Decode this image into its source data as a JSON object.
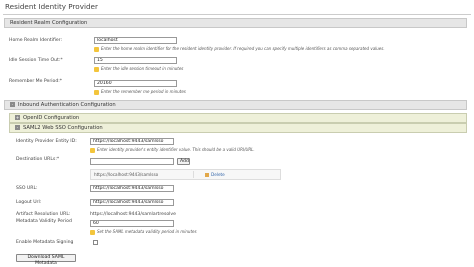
{
  "page": {
    "title": "Resident Identity Provider"
  },
  "realm": {
    "header": "Resident Realm Configuration",
    "home_realm": {
      "label": "Home Realm Identifier:",
      "value": "localhost",
      "help": "Enter the home realm identifier for the resident identity provider. If required you can specify multiple identifiers as comma separated values."
    },
    "idle": {
      "label": "Idle Session Time Out:*",
      "value": "15",
      "help": "Enter the idle session timeout in minutes"
    },
    "remember": {
      "label": "Remember Me Period:*",
      "value": "20160",
      "help": "Enter the remember me period in minutes"
    }
  },
  "inbound": {
    "header": "Inbound Authentication Configuration",
    "toggle": "-"
  },
  "openid": {
    "header": "OpenID Configuration",
    "toggle": "+"
  },
  "saml": {
    "header": "SAML2 Web SSO Configuration",
    "toggle": "-",
    "entity": {
      "label": "Identity Provider Entity ID:",
      "value": "https://localhost:9443/samlsso",
      "help": "Enter identity provider's entity identifier value. This should be a valid URI/URL."
    },
    "dest": {
      "label": "Destination URLs:*",
      "value": "",
      "add_label": "Add",
      "item": "https://localhost:9443/samlsso",
      "delete_label": "Delete"
    },
    "sso_url": {
      "label": "SSO URL:",
      "value": "https://localhost:9443/samlsso"
    },
    "logout_url": {
      "label": "Logout Url:",
      "value": "https://localhost:9443/samlsso"
    },
    "artifact": {
      "label": "Artifact Resolution URL:",
      "value": "https://localhost:9443/samlartresolve"
    },
    "metadata_validity": {
      "label": "Metadata Validity Period",
      "value": "60",
      "help": "Set the SAML metadata validity period in minutes"
    },
    "metadata_signing": {
      "label": "Enable Metadata Signing",
      "checked": false
    },
    "download_label": "Download SAML Metadata"
  },
  "icons": {
    "help": "help-icon",
    "delete": "delete-icon"
  }
}
